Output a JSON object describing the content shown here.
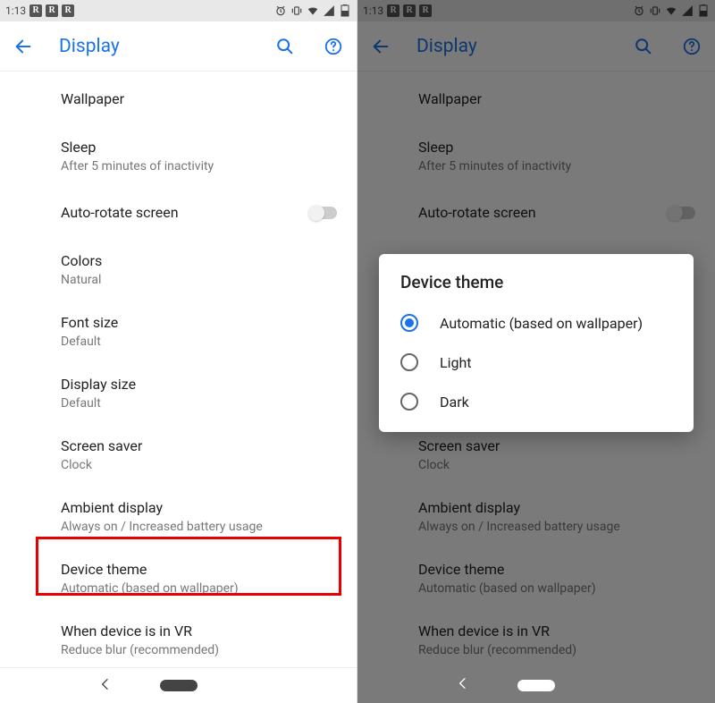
{
  "status": {
    "time": "1:13",
    "badge": "R"
  },
  "appbar": {
    "title": "Display"
  },
  "items": [
    {
      "title": "Wallpaper",
      "sub": ""
    },
    {
      "title": "Sleep",
      "sub": "After 5 minutes of inactivity"
    },
    {
      "title": "Auto-rotate screen",
      "sub": ""
    },
    {
      "title": "Colors",
      "sub": "Natural"
    },
    {
      "title": "Font size",
      "sub": "Default"
    },
    {
      "title": "Display size",
      "sub": "Default"
    },
    {
      "title": "Screen saver",
      "sub": "Clock"
    },
    {
      "title": "Ambient display",
      "sub": "Always on / Increased battery usage"
    },
    {
      "title": "Device theme",
      "sub": "Automatic (based on wallpaper)"
    },
    {
      "title": "When device is in VR",
      "sub": "Reduce blur (recommended)"
    }
  ],
  "dialog": {
    "title": "Device theme",
    "options": [
      {
        "label": "Automatic (based on wallpaper)",
        "checked": true
      },
      {
        "label": "Light",
        "checked": false
      },
      {
        "label": "Dark",
        "checked": false
      }
    ]
  }
}
